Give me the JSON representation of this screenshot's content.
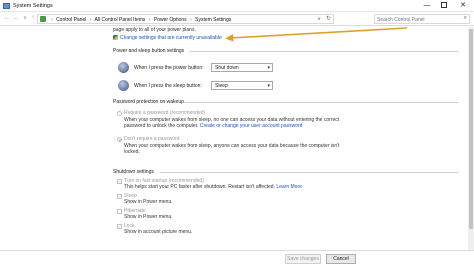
{
  "window": {
    "title": "System Settings",
    "minimize": "—",
    "close": "✕"
  },
  "addressbar": {
    "back": "←",
    "forward": "→",
    "recent": "∨",
    "up": "↑",
    "breadcrumbs": [
      "Control Panel",
      "All Control Panel Items",
      "Power Options",
      "System Settings"
    ],
    "separator": "›",
    "dropdown": "∨",
    "refresh": "↻",
    "search_placeholder": "Search Control Panel",
    "search_icon": "⌕"
  },
  "intro": {
    "text": "page apply to all of your power plans.",
    "change_link": "Change settings that are currently unavailable",
    "arrow_color": "#e0a030"
  },
  "power_buttons": {
    "section_title": "Power and sleep button settings",
    "rows": [
      {
        "label": "When I press the power button:",
        "value": "Shut down"
      },
      {
        "label": "When I press the sleep button:",
        "value": "Sleep"
      }
    ]
  },
  "password": {
    "section_title": "Password protection on wakeup",
    "require": {
      "label": "Require a password (recommended)",
      "desc1": "When your computer wakes from sleep, no one can access your data without entering the correct",
      "desc2": "password to unlock the computer.",
      "link": "Create or change your user account password"
    },
    "dont_require": {
      "label": "Don't require a password",
      "desc1": "When your computer wakes from sleep, anyone can access your data because the computer isn't",
      "desc2": "locked."
    }
  },
  "shutdown": {
    "section_title": "Shutdown settings",
    "items": [
      {
        "label": "Turn on fast startup (recommended)",
        "desc": "This helps start your PC faster after shutdown. Restart isn't affected.",
        "link": "Learn More",
        "checked": true
      },
      {
        "label": "Sleep",
        "desc": "Show in Power menu.",
        "checked": true
      },
      {
        "label": "Hibernate",
        "desc": "Show in Power menu.",
        "checked": false
      },
      {
        "label": "Lock",
        "desc": "Show in account picture menu.",
        "checked": true
      }
    ],
    "check_glyph": "✓"
  },
  "footer": {
    "save": "Save changes",
    "cancel": "Cancel"
  },
  "colors": {
    "link": "#1a56b8",
    "annotation_arrow": "#e0a030"
  }
}
